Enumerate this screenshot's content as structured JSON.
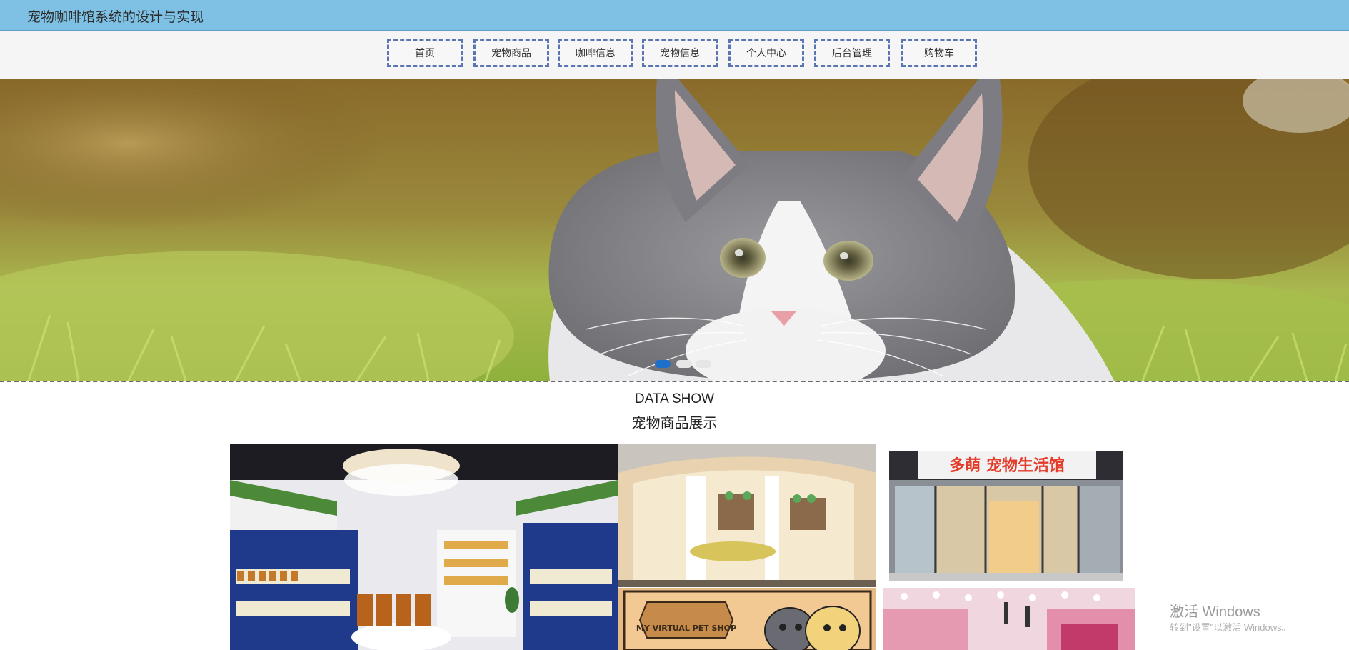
{
  "header": {
    "title": "宠物咖啡馆系统的设计与实现"
  },
  "nav": {
    "items": [
      {
        "label": "首页"
      },
      {
        "label": "宠物商品"
      },
      {
        "label": "咖啡信息"
      },
      {
        "label": "宠物信息"
      },
      {
        "label": "个人中心"
      },
      {
        "label": "后台管理"
      },
      {
        "label": "购物车"
      }
    ]
  },
  "carousel": {
    "slide_count": 3,
    "active_index": 0,
    "colors": {
      "active": "#1e6fc8",
      "inactive": "#e6e6e6"
    }
  },
  "showcase": {
    "title_en": "DATA SHOW",
    "title_cn": "宠物商品展示",
    "photo_texts": {
      "store_sign": "多萌 宠物生活馆",
      "shop_banner": "MY VIRTUAL PET SHOP"
    }
  },
  "watermark": {
    "title": "激活 Windows",
    "subtitle": "转到\"设置\"以激活 Windows。"
  },
  "colors": {
    "header_bg": "#7ec1e5",
    "nav_border": "#5b75b4"
  }
}
